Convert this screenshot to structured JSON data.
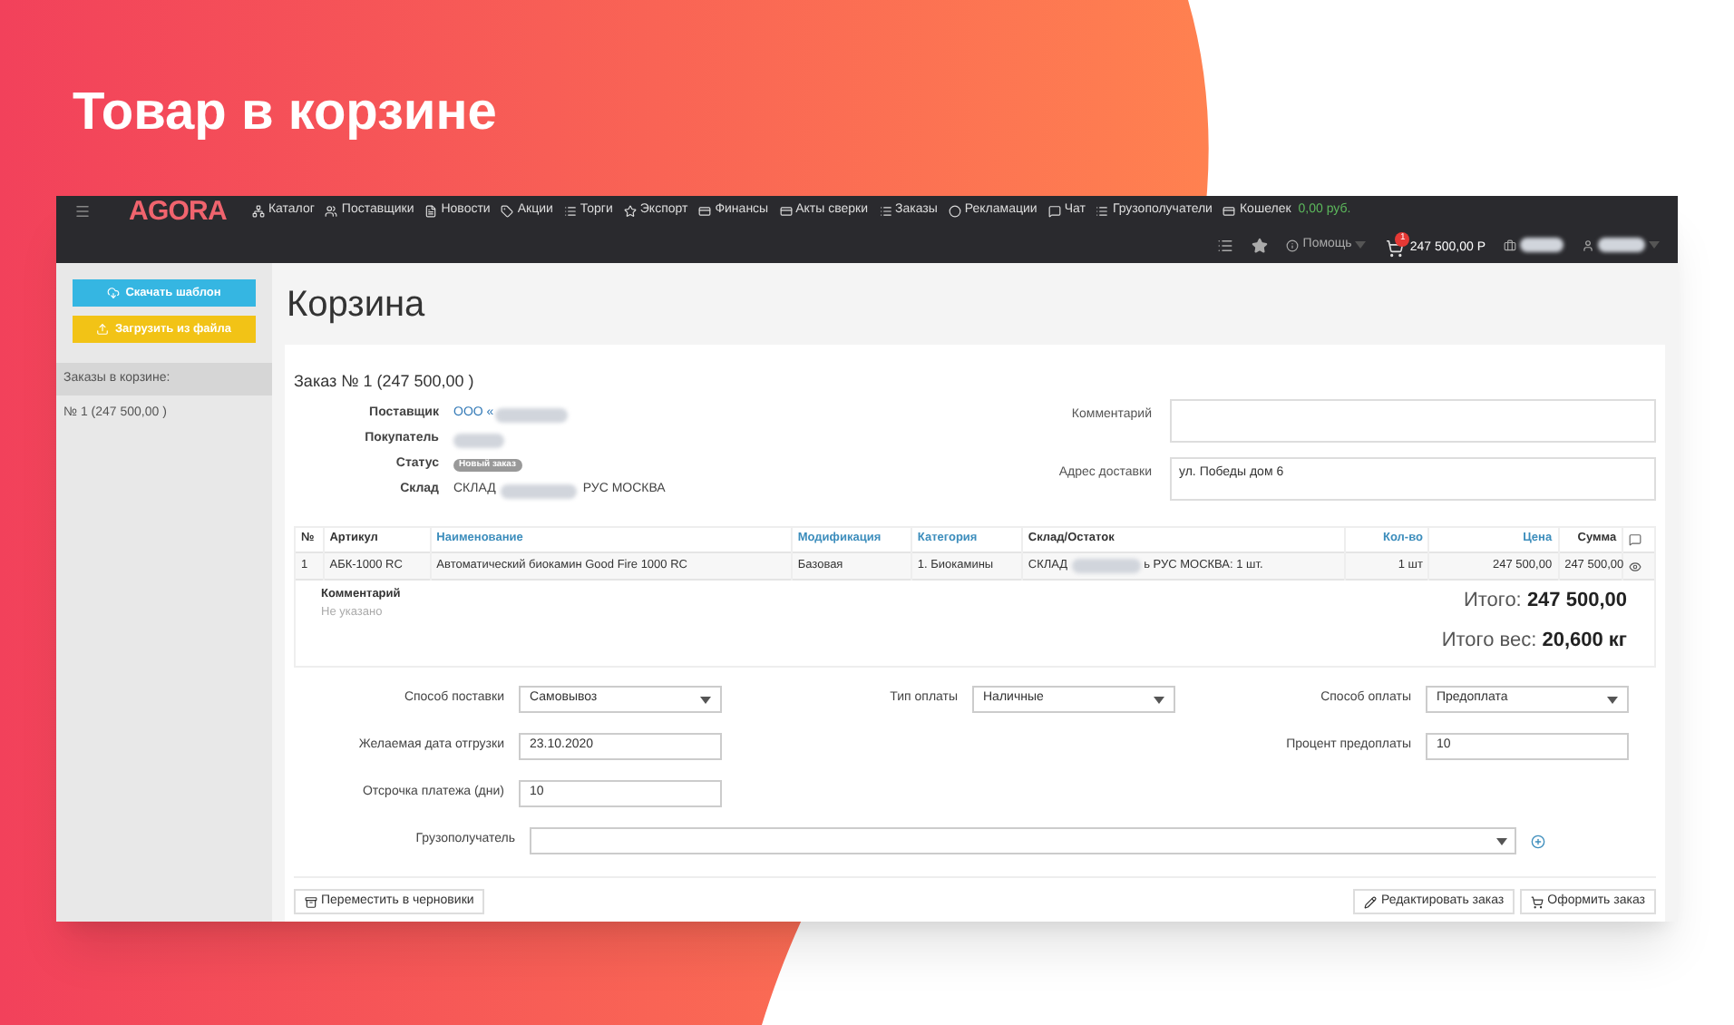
{
  "slide_title": "Товар в корзине",
  "navbar": {
    "logo": "AGORA",
    "items": [
      {
        "label": "Каталог"
      },
      {
        "label": "Поставщики"
      },
      {
        "label": "Новости"
      },
      {
        "label": "Акции"
      },
      {
        "label": "Торги"
      },
      {
        "label": "Экспорт"
      },
      {
        "label": "Финансы"
      },
      {
        "label": "Акты сверки"
      },
      {
        "label": "Заказы"
      },
      {
        "label": "Рекламации"
      },
      {
        "label": "Чат"
      },
      {
        "label": "Грузополучатели"
      },
      {
        "label": "Кошелек",
        "balance": "0,00 руб."
      }
    ],
    "help": "Помощь",
    "cart_count": "1",
    "cart_total": "247 500,00 Р"
  },
  "sidebar": {
    "buttons": [
      {
        "label": "Скачать шаблон",
        "color": "#35b6e2"
      },
      {
        "label": "Загрузить из файла",
        "color": "#f2c316"
      }
    ],
    "section_title": "Заказы в корзине:",
    "orders": [
      {
        "label": "№ 1 (247 500,00 )"
      }
    ]
  },
  "page_title": "Корзина",
  "order": {
    "title": "Заказ № 1 (247 500,00 )",
    "info": [
      {
        "label": "Поставщик",
        "value": "ООО «",
        "kind": "link"
      },
      {
        "label": "Покупатель",
        "kind": "hidden"
      },
      {
        "label": "Статус",
        "value": "Новый заказ",
        "kind": "badge"
      },
      {
        "label": "Склад",
        "value": "СКЛАД",
        "value_after": "РУС МОСКВА",
        "kind": "masked"
      }
    ],
    "comment": {
      "label": "Комментарий"
    },
    "address": {
      "label": "Адрес доставки",
      "value": "ул. Победы дом 6"
    },
    "table": {
      "columns": [
        {
          "label": "№",
          "sortable": false
        },
        {
          "label": "Артикул",
          "sortable": false
        },
        {
          "label": "Наименование",
          "sortable": true
        },
        {
          "label": "Модификация",
          "sortable": true
        },
        {
          "label": "Категория",
          "sortable": true
        },
        {
          "label": "Склад/Остаток",
          "sortable": false
        },
        {
          "label": "Кол-во",
          "sortable": true
        },
        {
          "label": "Цена",
          "sortable": true
        },
        {
          "label": "Сумма",
          "sortable": false
        }
      ],
      "rows": [
        {
          "cells": [
            "1",
            "АБК-1000 RC",
            "Автоматический биокамин Good Fire 1000 RC",
            "Базовая",
            "1. Биокамины",
            "СКЛАД",
            "1 шт",
            "247 500,00",
            "247 500,00"
          ],
          "stock_after": "ь РУС МОСКВА: 1 шт."
        }
      ]
    },
    "comment_label": "Комментарий",
    "comment_value": "Не указано",
    "total_label": "Итого:",
    "total_value": "247 500,00",
    "weight_label": "Итого вес:",
    "weight_value": "20,600 кг",
    "form_rows": [
      {
        "left": {
          "label": "Способ поставки",
          "kind": "select",
          "value": "Самовывоз"
        },
        "middle": {
          "label": "Тип оплаты",
          "kind": "select",
          "value": "Наличные"
        },
        "right": {
          "label": "Способ оплаты",
          "kind": "select",
          "value": "Предоплата"
        }
      },
      {
        "left": {
          "label": "Желаемая дата отгрузки",
          "kind": "input",
          "value": "23.10.2020"
        },
        "right": {
          "label": "Процент предоплаты",
          "kind": "input",
          "value": "10"
        }
      },
      {
        "left": {
          "label": "Отсрочка платежа (дни)",
          "kind": "input",
          "value": "10"
        }
      }
    ],
    "consignee": {
      "label": "Грузополучатель"
    },
    "buttons": [
      {
        "label": "Переместить в черновики",
        "kind": "drafts"
      },
      {
        "label": "Редактировать заказ",
        "kind": "edit"
      },
      {
        "label": "Оформить заказ",
        "kind": "cart"
      }
    ]
  }
}
